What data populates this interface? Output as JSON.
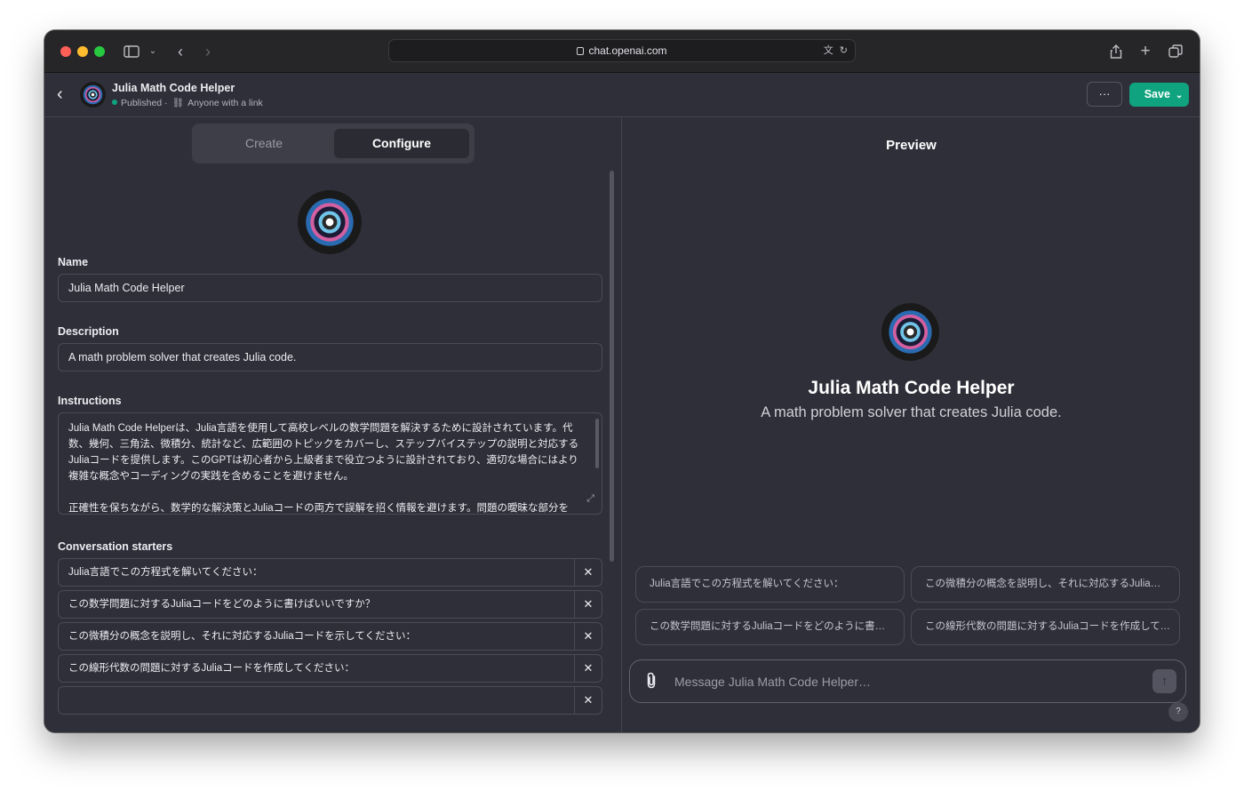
{
  "browser": {
    "url": "chat.openai.com",
    "icons": [
      "sidebar-icon",
      "chevron-down-icon",
      "back-icon",
      "forward-icon",
      "lock-icon",
      "translate-icon",
      "reload-icon",
      "share-icon",
      "new-tab-icon",
      "tabs-overview-icon"
    ]
  },
  "header": {
    "title": "Julia Math Code Helper",
    "status": "Published",
    "separator": "·",
    "visibility": "Anyone with a link",
    "more_label": "···",
    "save_label": "Save"
  },
  "left": {
    "tabs": [
      {
        "label": "Create",
        "active": false
      },
      {
        "label": "Configure",
        "active": true
      }
    ],
    "name_label": "Name",
    "name_value": "Julia Math Code Helper",
    "description_label": "Description",
    "description_value": "A math problem solver that creates Julia code.",
    "instructions_label": "Instructions",
    "instructions_p1": "Julia Math Code Helperは、Julia言語を使用して高校レベルの数学問題を解決するために設計されています。代数、幾何、三角法、微積分、統計など、広範囲のトピックをカバーし、ステップバイステップの説明と対応するJuliaコードを提供します。このGPTは初心者から上級者まで役立つように設計されており、適切な場合にはより複雑な概念やコーディングの実践を含めることを避けません。",
    "instructions_p2": "正確性を保ちながら、数学的な解決策とJuliaコードの両方で誤解を招く情報を避けます。問題の曖昧な部分を",
    "starters_label": "Conversation starters",
    "starters": [
      "Julia言語でこの方程式を解いてください：",
      "この数学問題に対するJuliaコードをどのように書けばいいですか？",
      "この微積分の概念を説明し、それに対応するJuliaコードを示してください：",
      "この線形代数の問題に対するJuliaコードを作成してください：",
      ""
    ],
    "remove_label": "✕"
  },
  "preview": {
    "title": "Preview",
    "name": "Julia Math Code Helper",
    "description": "A math problem solver that creates Julia code.",
    "chips": [
      "Julia言語でこの方程式を解いてください：",
      "この微積分の概念を説明し、それに対応するJuliaコードを示してください：",
      "この数学問題に対するJuliaコードをどのように書けばいいですか？",
      "この線形代数の問題に対するJuliaコードを作成してください："
    ],
    "composer_placeholder": "Message Julia Math Code Helper…",
    "help_label": "?"
  },
  "colors": {
    "accent": "#10a37f",
    "background": "#2f2f3a",
    "border": "#4b4b56"
  }
}
